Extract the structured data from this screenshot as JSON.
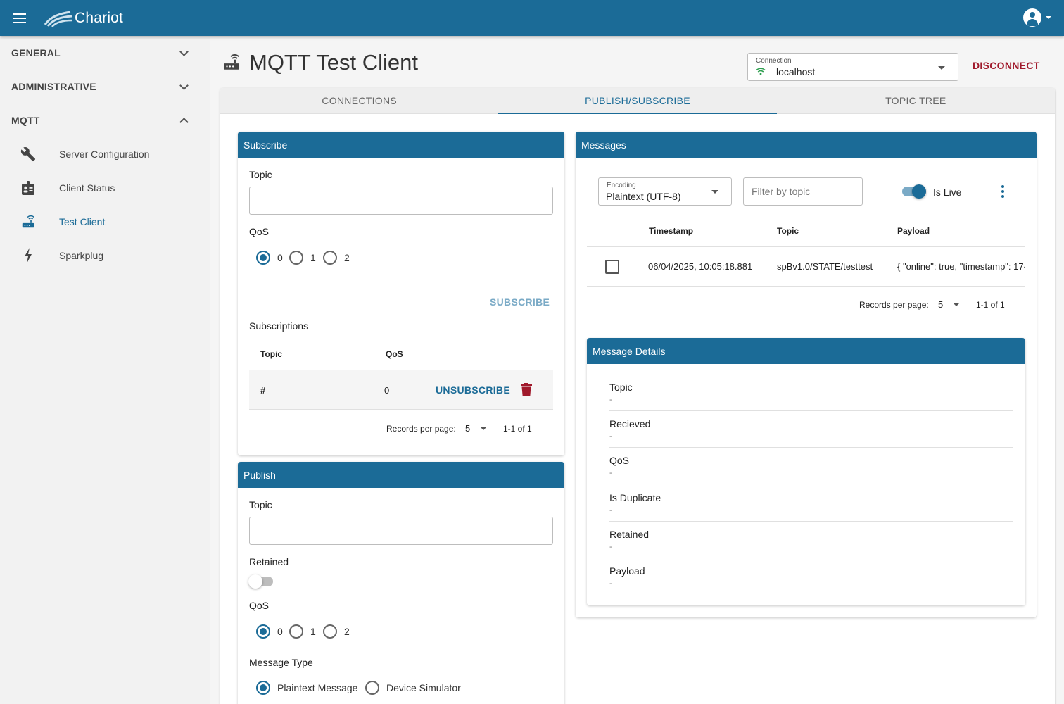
{
  "app": {
    "name": "Chariot",
    "colors": {
      "primary": "#1b6b97",
      "danger": "#a0192b"
    }
  },
  "sidebar": {
    "groups": [
      {
        "label": "GENERAL",
        "expanded": false
      },
      {
        "label": "ADMINISTRATIVE",
        "expanded": false
      },
      {
        "label": "MQTT",
        "expanded": true
      }
    ],
    "items": [
      {
        "label": "Server Configuration",
        "icon": "wrench-icon"
      },
      {
        "label": "Client Status",
        "icon": "badge-icon"
      },
      {
        "label": "Test Client",
        "icon": "router-icon",
        "active": true
      },
      {
        "label": "Sparkplug",
        "icon": "lightning-icon"
      }
    ]
  },
  "page": {
    "title": "MQTT Test Client",
    "connection": {
      "label": "Connection",
      "value": "localhost"
    },
    "disconnect_label": "DISCONNECT"
  },
  "tabs": [
    {
      "label": "CONNECTIONS"
    },
    {
      "label": "PUBLISH/SUBSCRIBE",
      "active": true
    },
    {
      "label": "TOPIC TREE"
    }
  ],
  "subscribe": {
    "header": "Subscribe",
    "topic_label": "Topic",
    "topic_value": "",
    "qos_label": "QoS",
    "qos_options": [
      "0",
      "1",
      "2"
    ],
    "qos_selected": "0",
    "subscribe_label": "SUBSCRIBE",
    "subscriptions_label": "Subscriptions",
    "columns": [
      "Topic",
      "QoS"
    ],
    "rows": [
      {
        "topic": "#",
        "qos": "0",
        "action": "UNSUBSCRIBE"
      }
    ],
    "records_label": "Records per page:",
    "records_value": "5",
    "range": "1-1 of 1"
  },
  "publish": {
    "header": "Publish",
    "topic_label": "Topic",
    "topic_value": "",
    "retained_label": "Retained",
    "retained": false,
    "qos_label": "QoS",
    "qos_options": [
      "0",
      "1",
      "2"
    ],
    "qos_selected": "0",
    "message_type_label": "Message Type",
    "message_types": [
      "Plaintext Message",
      "Device Simulator"
    ],
    "message_type_selected": "Plaintext Message"
  },
  "messages": {
    "header": "Messages",
    "encoding_label": "Encoding",
    "encoding_value": "Plaintext (UTF-8)",
    "filter_placeholder": "Filter by topic",
    "is_live_label": "Is Live",
    "is_live": true,
    "columns": [
      "Timestamp",
      "Topic",
      "Payload"
    ],
    "rows": [
      {
        "timestamp": "06/04/2025, 10:05:18.881",
        "topic": "spBv1.0/STATE/testtest",
        "payload": "{ \"online\": true, \"timestamp\": 174"
      }
    ],
    "records_label": "Records per page:",
    "records_value": "5",
    "range": "1-1 of 1"
  },
  "details": {
    "header": "Message Details",
    "fields": [
      {
        "label": "Topic",
        "value": "-"
      },
      {
        "label": "Recieved",
        "value": "-"
      },
      {
        "label": "QoS",
        "value": "-"
      },
      {
        "label": "Is Duplicate",
        "value": "-"
      },
      {
        "label": "Retained",
        "value": "-"
      },
      {
        "label": "Payload",
        "value": "-"
      }
    ]
  }
}
